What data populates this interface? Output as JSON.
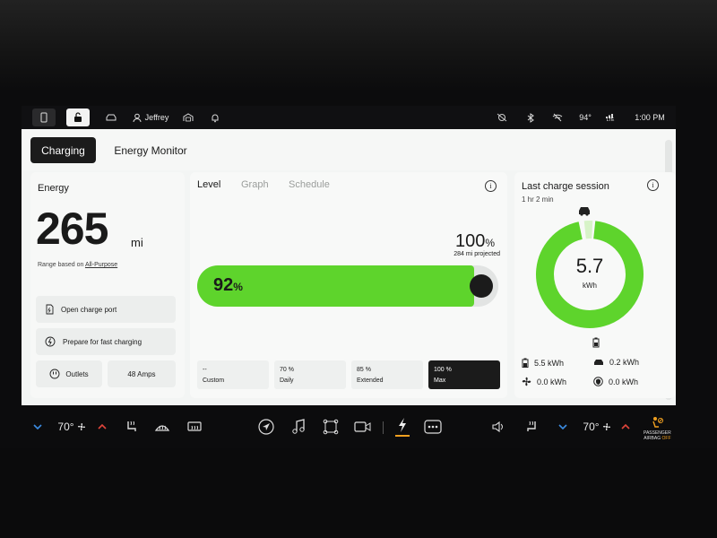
{
  "status_bar": {
    "user_name": "Jeffrey",
    "temperature": "94°",
    "time": "1:00 PM",
    "lte": "LTE"
  },
  "tabs": [
    {
      "label": "Charging",
      "active": true
    },
    {
      "label": "Energy Monitor",
      "active": false
    }
  ],
  "energy": {
    "title": "Energy",
    "range_value": "265",
    "range_unit": "mi",
    "range_based_label": "Range based on",
    "range_mode": "All-Purpose",
    "actions": {
      "open_charge_port": "Open charge port",
      "prepare_fast_charging": "Prepare for fast charging",
      "outlets": "Outlets",
      "amps": "48 Amps"
    }
  },
  "level": {
    "subtabs": [
      {
        "label": "Level",
        "active": true
      },
      {
        "label": "Graph",
        "active": false
      },
      {
        "label": "Schedule",
        "active": false
      }
    ],
    "target_value": "100",
    "target_unit": "%",
    "projected": "284 mi projected",
    "current_value": "92",
    "current_unit": "%",
    "current_fraction": 0.92,
    "presets": [
      {
        "value": "--",
        "name": "Custom",
        "active": false
      },
      {
        "value": "70 %",
        "name": "Daily",
        "active": false
      },
      {
        "value": "85 %",
        "name": "Extended",
        "active": false
      },
      {
        "value": "100 %",
        "name": "Max",
        "active": true
      }
    ]
  },
  "last_session": {
    "title": "Last charge session",
    "duration": "1 hr 2 min",
    "energy_value": "5.7",
    "energy_unit": "kWh",
    "stats": {
      "battery": "5.5 kWh",
      "vehicle": "0.2 kWh",
      "climate": "0.0 kWh",
      "other": "0.0 kWh"
    },
    "colors": {
      "ring": "#5ed42c"
    }
  },
  "climate_bar": {
    "left_temp": "70°",
    "right_temp": "70°",
    "airbag_line1": "PASSENGER",
    "airbag_line2": "AIRBAG",
    "airbag_state": "OFF"
  },
  "colors": {
    "accent_green": "#5ed42c",
    "dark": "#1b1b1b",
    "active_underline": "#f0a020"
  }
}
